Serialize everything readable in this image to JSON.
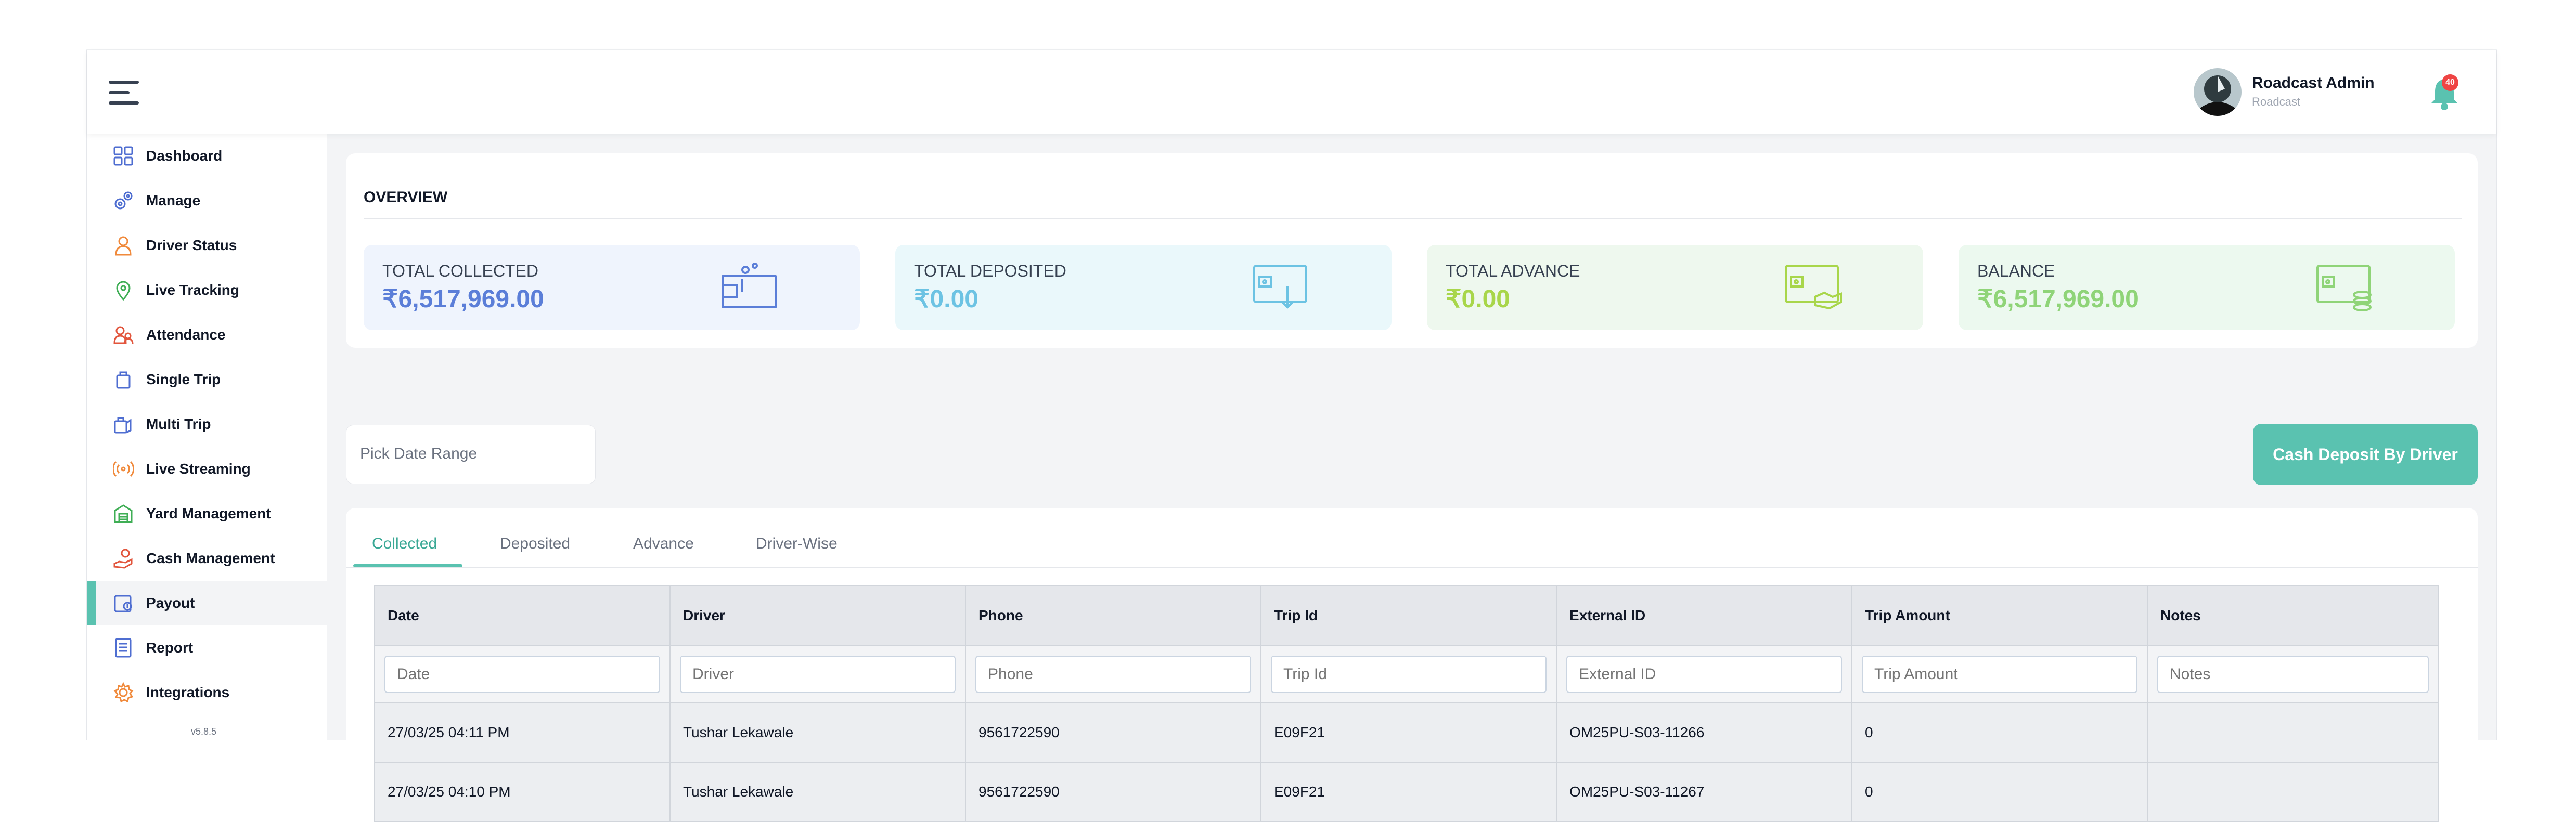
{
  "user": {
    "name": "Roadcast Admin",
    "org": "Roadcast",
    "notifications": "40"
  },
  "sidebar": {
    "items": [
      {
        "label": "Dashboard",
        "icon": "dashboard-grid-icon"
      },
      {
        "label": "Manage",
        "icon": "gears-icon"
      },
      {
        "label": "Driver Status",
        "icon": "person-icon"
      },
      {
        "label": "Live Tracking",
        "icon": "location-pin-icon"
      },
      {
        "label": "Attendance",
        "icon": "people-icon"
      },
      {
        "label": "Single Trip",
        "icon": "bag-icon"
      },
      {
        "label": "Multi Trip",
        "icon": "bags-icon"
      },
      {
        "label": "Live Streaming",
        "icon": "broadcast-icon"
      },
      {
        "label": "Yard Management",
        "icon": "warehouse-icon"
      },
      {
        "label": "Cash Management",
        "icon": "cash-hand-icon"
      },
      {
        "label": "Payout",
        "icon": "payout-icon"
      },
      {
        "label": "Report",
        "icon": "report-icon"
      },
      {
        "label": "Integrations",
        "icon": "settings-cog-icon"
      }
    ],
    "active": "Payout",
    "version": "v5.8.5"
  },
  "overview": {
    "title": "OVERVIEW",
    "stats": [
      {
        "label": "TOTAL COLLECTED",
        "value": "₹6,517,969.00",
        "color": "#5b7ed8",
        "bg": "#eff4fd"
      },
      {
        "label": "TOTAL DEPOSITED",
        "value": "₹0.00",
        "color": "#6cc3e3",
        "bg": "#eaf8fb"
      },
      {
        "label": "TOTAL ADVANCE",
        "value": "₹0.00",
        "color": "#a8d64a",
        "bg": "#eef8ee"
      },
      {
        "label": "BALANCE",
        "value": "₹6,517,969.00",
        "color": "#8fd478",
        "bg": "#ecf9ef"
      }
    ]
  },
  "filters": {
    "date_range_placeholder": "Pick Date Range",
    "deposit_button": "Cash Deposit By Driver"
  },
  "tabs": [
    "Collected",
    "Deposited",
    "Advance",
    "Driver-Wise"
  ],
  "active_tab": "Collected",
  "table": {
    "columns": [
      "Date",
      "Driver",
      "Phone",
      "Trip Id",
      "External ID",
      "Trip Amount",
      "Notes"
    ],
    "filter_placeholders": [
      "Date",
      "Driver",
      "Phone",
      "Trip Id",
      "External ID",
      "Trip Amount",
      "Notes"
    ],
    "rows": [
      [
        "27/03/25 04:11 PM",
        "Tushar Lekawale",
        "9561722590",
        "E09F21",
        "OM25PU-S03-11266",
        "0",
        ""
      ],
      [
        "27/03/25 04:10 PM",
        "Tushar Lekawale",
        "9561722590",
        "E09F21",
        "OM25PU-S03-11267",
        "0",
        ""
      ]
    ]
  },
  "colors": {
    "accent": "#5ac2b0"
  }
}
